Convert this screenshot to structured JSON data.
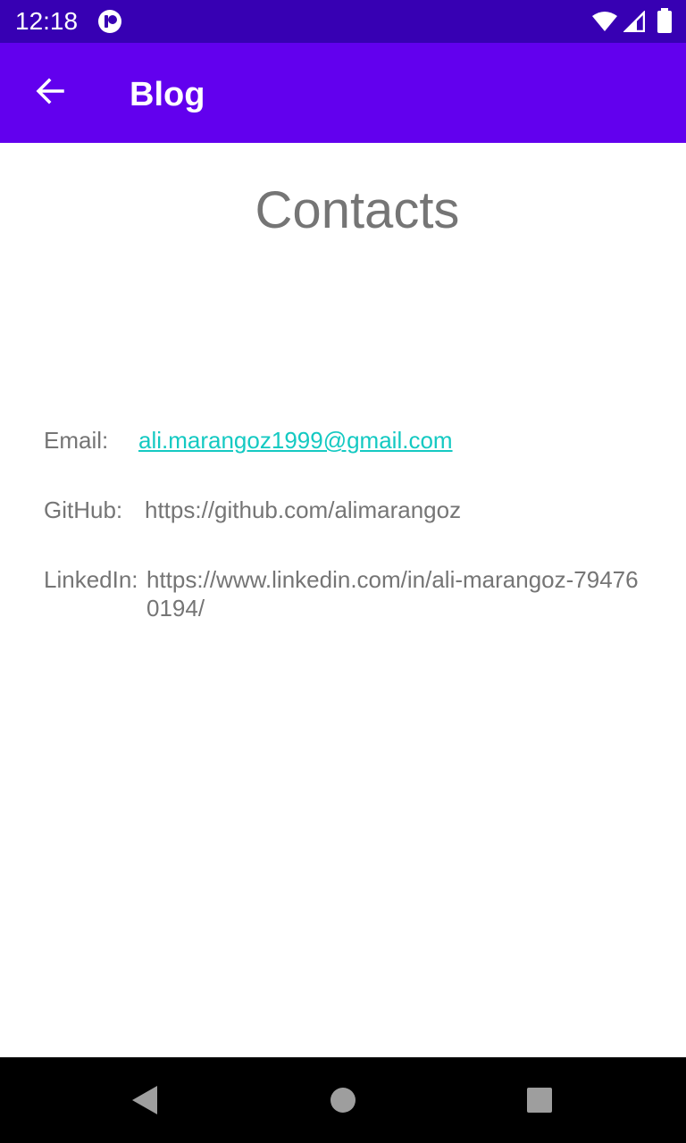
{
  "status_bar": {
    "time": "12:18",
    "icons": [
      "app-notification-icon",
      "wifi-icon",
      "cell-signal-icon",
      "battery-icon"
    ]
  },
  "app_bar": {
    "title": "Blog",
    "back_icon": "arrow-back-icon"
  },
  "page": {
    "heading": "Contacts",
    "rows": [
      {
        "label": "Email:",
        "value": "ali.marangoz1999@gmail.com"
      },
      {
        "label": "GitHub:",
        "value": "https://github.com/alimarangoz"
      },
      {
        "label": "LinkedIn:",
        "value": "https://www.linkedin.com/in/ali-marangoz-794760194/"
      }
    ]
  },
  "nav_bar": {
    "icons": [
      "back-triangle-icon",
      "home-circle-icon",
      "recents-square-icon"
    ]
  },
  "colors": {
    "status_bar": "#3700b3",
    "app_bar": "#6200ee",
    "link": "#14c9c2",
    "text_gray": "#757575"
  }
}
